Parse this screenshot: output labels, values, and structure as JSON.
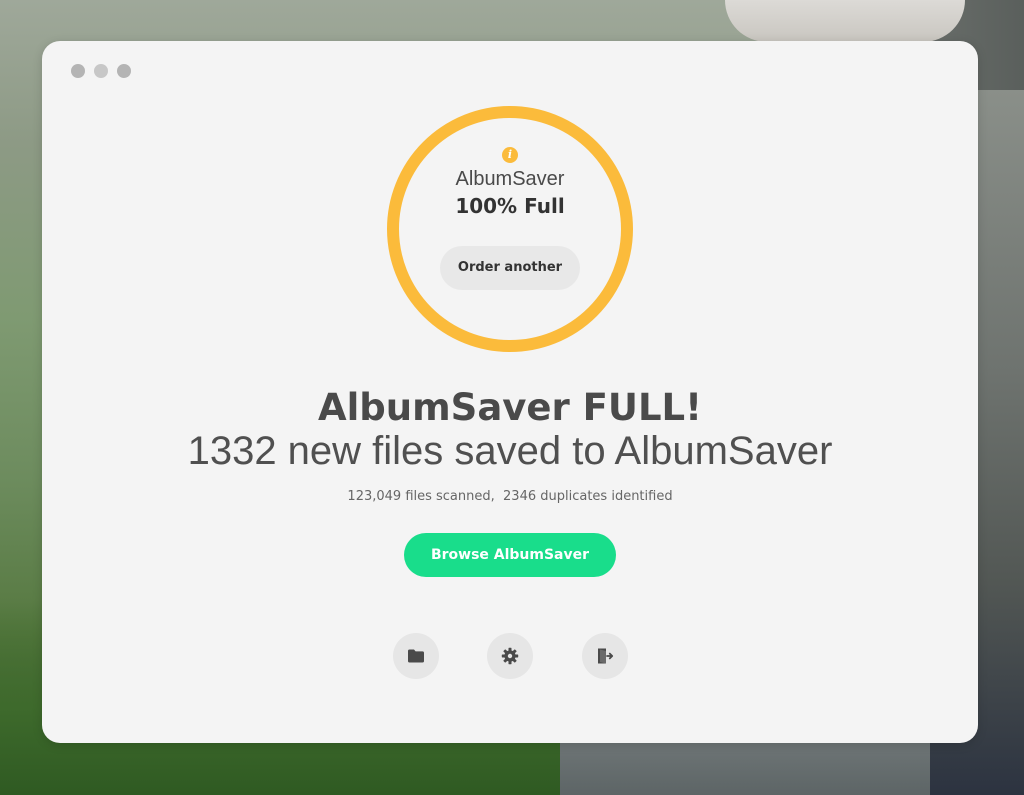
{
  "window": {
    "controls": [
      "close",
      "minimize",
      "maximize"
    ]
  },
  "status_ring": {
    "icon": "info-icon",
    "app_name": "AlbumSaver",
    "status": "100% Full",
    "fill_percent": 100,
    "ring_color": "#fbbb3b",
    "order_button_label": "Order another"
  },
  "main": {
    "headline": "AlbumSaver FULL!",
    "subheadline": "1332 new files saved to AlbumSaver",
    "stats": "123,049 files scanned,  2346 duplicates identified",
    "browse_button_label": "Browse AlbumSaver",
    "accent_color": "#19dd8b"
  },
  "toolbar": {
    "icons": [
      "folder-icon",
      "gear-icon",
      "exit-icon"
    ]
  }
}
